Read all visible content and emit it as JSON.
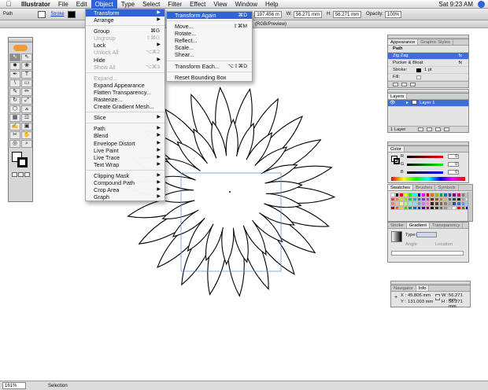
{
  "menubar": {
    "apple": "",
    "items": [
      "Illustrator",
      "File",
      "Edit",
      "Object",
      "Type",
      "Select",
      "Filter",
      "Effect",
      "View",
      "Window",
      "Help"
    ],
    "active_index": 3,
    "clock": "Sat 9:23 AM"
  },
  "controlbar": {
    "selection_label": "Path",
    "stroke_label": "Stroke",
    "x_value": "197.456 m",
    "w_value": "56.271 mm",
    "h_value": "56.271 mm",
    "opacity_value": "100%"
  },
  "document": {
    "title": "(RGB/Preview)"
  },
  "statusbar": {
    "zoom": "161%",
    "status": "Selection"
  },
  "object_menu": {
    "groups": [
      [
        {
          "label": "Transform",
          "sub": true,
          "hi": true
        },
        {
          "label": "Arrange",
          "sub": true
        }
      ],
      [
        {
          "label": "Group",
          "sc": "⌘G"
        },
        {
          "label": "Ungroup",
          "sc": "⇧⌘G",
          "dis": true
        },
        {
          "label": "Lock",
          "sub": true
        },
        {
          "label": "Unlock All",
          "sc": "⌥⌘2",
          "dis": true
        },
        {
          "label": "Hide",
          "sub": true
        },
        {
          "label": "Show All",
          "sc": "⌥⌘3",
          "dis": true
        }
      ],
      [
        {
          "label": "Expand...",
          "dis": true
        },
        {
          "label": "Expand Appearance"
        },
        {
          "label": "Flatten Transparency..."
        },
        {
          "label": "Rasterize..."
        },
        {
          "label": "Create Gradient Mesh..."
        }
      ],
      [
        {
          "label": "Slice",
          "sub": true
        }
      ],
      [
        {
          "label": "Path",
          "sub": true
        },
        {
          "label": "Blend",
          "sub": true
        },
        {
          "label": "Envelope Distort",
          "sub": true
        },
        {
          "label": "Live Paint",
          "sub": true
        },
        {
          "label": "Live Trace",
          "sub": true
        },
        {
          "label": "Text Wrap",
          "sub": true
        }
      ],
      [
        {
          "label": "Clipping Mask",
          "sub": true
        },
        {
          "label": "Compound Path",
          "sub": true
        },
        {
          "label": "Crop Area",
          "sub": true
        },
        {
          "label": "Graph",
          "sub": true
        }
      ]
    ]
  },
  "transform_menu": {
    "groups": [
      [
        {
          "label": "Transform Again",
          "sc": "⌘D",
          "hi": true
        }
      ],
      [
        {
          "label": "Move...",
          "sc": "⇧⌘M"
        },
        {
          "label": "Rotate..."
        },
        {
          "label": "Reflect..."
        },
        {
          "label": "Scale..."
        },
        {
          "label": "Shear..."
        }
      ],
      [
        {
          "label": "Transform Each...",
          "sc": "⌥⇧⌘D"
        }
      ],
      [
        {
          "label": "Reset Bounding Box"
        }
      ]
    ]
  },
  "appearance_panel": {
    "tabs": [
      "Appearance",
      "Graphic Styles"
    ],
    "header": "Path",
    "rows": [
      "Zig Zag",
      "Pucker & Bloat",
      "Stroke:",
      "Fill:"
    ],
    "stroke_weight": "1 pt",
    "selected_row": 0
  },
  "layers_panel": {
    "tabs": [
      "Layers"
    ],
    "layer_name": "Layer 1",
    "footer": "1 Layer"
  },
  "color_panel": {
    "tabs": [
      "Color"
    ],
    "channels": [
      {
        "label": "R",
        "value": "0"
      },
      {
        "label": "G",
        "value": "0"
      },
      {
        "label": "B",
        "value": "0"
      }
    ]
  },
  "swatches_panel": {
    "tabs": [
      "Swatches",
      "Brushes",
      "Symbols"
    ],
    "colors": [
      "#ffffff",
      "#000000",
      "#ff0000",
      "#ffff00",
      "#00ff00",
      "#00ffff",
      "#0000ff",
      "#ff00ff",
      "#c00000",
      "#e07000",
      "#8ac800",
      "#00a050",
      "#0080c0",
      "#3040a0",
      "#8000a0",
      "#e00070",
      "#808080",
      "#c0c0c0",
      "#e04040",
      "#f08030",
      "#f0d020",
      "#a0d040",
      "#40b070",
      "#30a0c0",
      "#4060c0",
      "#7040b0",
      "#c040a0",
      "#5a3020",
      "#8a5a30",
      "#b08050",
      "#d0b080",
      "#606060",
      "#404040",
      "#202020",
      "#a0a0a0",
      "#e0e0e0",
      "#ff8080",
      "#ffc080",
      "#ffff80",
      "#c0ff80",
      "#80ffc0",
      "#80e0ff",
      "#8090ff",
      "#c080ff",
      "#ff80c0",
      "#402000",
      "#604020",
      "#806040",
      "#a08060",
      "#c0a080",
      "#2050a0",
      "#3070c0",
      "#50a0e0",
      "#90d0f0",
      "#b00000",
      "#ff6000",
      "#ffd000",
      "#60c000",
      "#009060",
      "#0070a0",
      "#2030a0",
      "#600080",
      "#a00060",
      "#000000",
      "#333333",
      "#666666",
      "#999999",
      "#cccccc",
      "#ffffff",
      "#ff0000",
      "#00a000",
      "#0000c0"
    ]
  },
  "gradient_panel": {
    "tabs": [
      "Stroke",
      "Gradient",
      "Transparency"
    ],
    "type_label": "Type:",
    "angle_label": "Angle",
    "location_label": "Location"
  },
  "info_panel": {
    "tabs": [
      "Navigator",
      "Info"
    ],
    "x": "45.806 mm",
    "y": "131.003 mm",
    "w": "56.271 mm",
    "h": "56.271 mm"
  },
  "tools": {
    "icons": [
      "↖",
      "⇖",
      "✸",
      "❀",
      "✒",
      "T",
      "\\",
      "▭",
      "✎",
      "✏",
      "↻",
      "⤢",
      "⬡",
      "⩟",
      "▦",
      "☲",
      "✍",
      "▣",
      "✂",
      "✋",
      "◎",
      "⌕"
    ]
  }
}
